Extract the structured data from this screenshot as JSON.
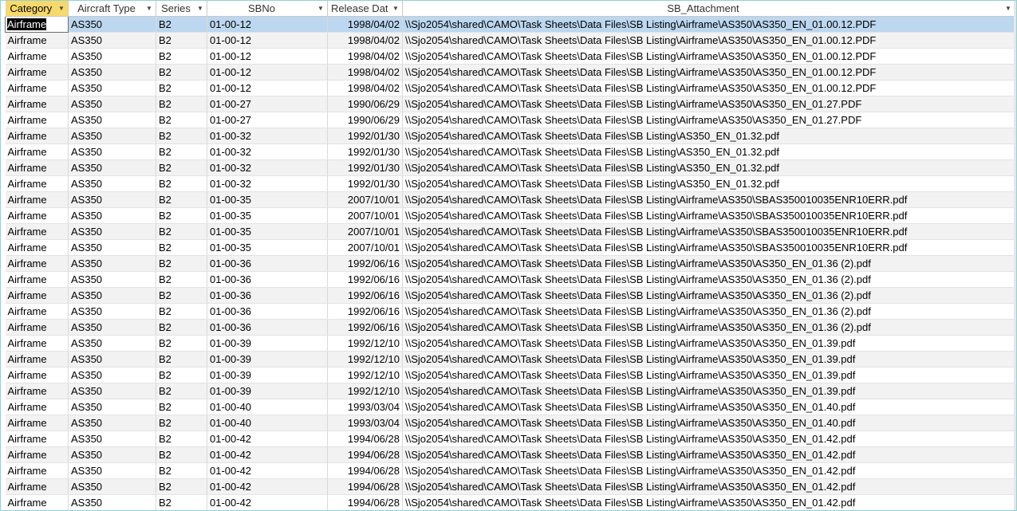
{
  "columns": [
    {
      "label": "Category"
    },
    {
      "label": "Aircraft Type"
    },
    {
      "label": "Series"
    },
    {
      "label": "SBNo"
    },
    {
      "label": "Release Dat"
    },
    {
      "label": "SB_Attachment"
    }
  ],
  "rows": [
    [
      "Airframe",
      "AS350",
      "B2",
      "01-00-12",
      "1998/04/02",
      "\\\\Sjo2054\\shared\\CAMO\\Task Sheets\\Data Files\\SB Listing\\Airframe\\AS350\\AS350_EN_01.00.12.PDF"
    ],
    [
      "Airframe",
      "AS350",
      "B2",
      "01-00-12",
      "1998/04/02",
      "\\\\Sjo2054\\shared\\CAMO\\Task Sheets\\Data Files\\SB Listing\\Airframe\\AS350\\AS350_EN_01.00.12.PDF"
    ],
    [
      "Airframe",
      "AS350",
      "B2",
      "01-00-12",
      "1998/04/02",
      "\\\\Sjo2054\\shared\\CAMO\\Task Sheets\\Data Files\\SB Listing\\Airframe\\AS350\\AS350_EN_01.00.12.PDF"
    ],
    [
      "Airframe",
      "AS350",
      "B2",
      "01-00-12",
      "1998/04/02",
      "\\\\Sjo2054\\shared\\CAMO\\Task Sheets\\Data Files\\SB Listing\\Airframe\\AS350\\AS350_EN_01.00.12.PDF"
    ],
    [
      "Airframe",
      "AS350",
      "B2",
      "01-00-12",
      "1998/04/02",
      "\\\\Sjo2054\\shared\\CAMO\\Task Sheets\\Data Files\\SB Listing\\Airframe\\AS350\\AS350_EN_01.00.12.PDF"
    ],
    [
      "Airframe",
      "AS350",
      "B2",
      "01-00-27",
      "1990/06/29",
      "\\\\Sjo2054\\shared\\CAMO\\Task Sheets\\Data Files\\SB Listing\\Airframe\\AS350\\AS350_EN_01.27.PDF"
    ],
    [
      "Airframe",
      "AS350",
      "B2",
      "01-00-27",
      "1990/06/29",
      "\\\\Sjo2054\\shared\\CAMO\\Task Sheets\\Data Files\\SB Listing\\Airframe\\AS350\\AS350_EN_01.27.PDF"
    ],
    [
      "Airframe",
      "AS350",
      "B2",
      "01-00-32",
      "1992/01/30",
      "\\\\Sjo2054\\shared\\CAMO\\Task Sheets\\Data Files\\SB Listing\\AS350_EN_01.32.pdf"
    ],
    [
      "Airframe",
      "AS350",
      "B2",
      "01-00-32",
      "1992/01/30",
      "\\\\Sjo2054\\shared\\CAMO\\Task Sheets\\Data Files\\SB Listing\\AS350_EN_01.32.pdf"
    ],
    [
      "Airframe",
      "AS350",
      "B2",
      "01-00-32",
      "1992/01/30",
      "\\\\Sjo2054\\shared\\CAMO\\Task Sheets\\Data Files\\SB Listing\\AS350_EN_01.32.pdf"
    ],
    [
      "Airframe",
      "AS350",
      "B2",
      "01-00-32",
      "1992/01/30",
      "\\\\Sjo2054\\shared\\CAMO\\Task Sheets\\Data Files\\SB Listing\\AS350_EN_01.32.pdf"
    ],
    [
      "Airframe",
      "AS350",
      "B2",
      "01-00-35",
      "2007/10/01",
      "\\\\Sjo2054\\shared\\CAMO\\Task Sheets\\Data Files\\SB Listing\\Airframe\\AS350\\SBAS350010035ENR10ERR.pdf"
    ],
    [
      "Airframe",
      "AS350",
      "B2",
      "01-00-35",
      "2007/10/01",
      "\\\\Sjo2054\\shared\\CAMO\\Task Sheets\\Data Files\\SB Listing\\Airframe\\AS350\\SBAS350010035ENR10ERR.pdf"
    ],
    [
      "Airframe",
      "AS350",
      "B2",
      "01-00-35",
      "2007/10/01",
      "\\\\Sjo2054\\shared\\CAMO\\Task Sheets\\Data Files\\SB Listing\\Airframe\\AS350\\SBAS350010035ENR10ERR.pdf"
    ],
    [
      "Airframe",
      "AS350",
      "B2",
      "01-00-35",
      "2007/10/01",
      "\\\\Sjo2054\\shared\\CAMO\\Task Sheets\\Data Files\\SB Listing\\Airframe\\AS350\\SBAS350010035ENR10ERR.pdf"
    ],
    [
      "Airframe",
      "AS350",
      "B2",
      "01-00-36",
      "1992/06/16",
      "\\\\Sjo2054\\shared\\CAMO\\Task Sheets\\Data Files\\SB Listing\\Airframe\\AS350\\AS350_EN_01.36 (2).pdf"
    ],
    [
      "Airframe",
      "AS350",
      "B2",
      "01-00-36",
      "1992/06/16",
      "\\\\Sjo2054\\shared\\CAMO\\Task Sheets\\Data Files\\SB Listing\\Airframe\\AS350\\AS350_EN_01.36 (2).pdf"
    ],
    [
      "Airframe",
      "AS350",
      "B2",
      "01-00-36",
      "1992/06/16",
      "\\\\Sjo2054\\shared\\CAMO\\Task Sheets\\Data Files\\SB Listing\\Airframe\\AS350\\AS350_EN_01.36 (2).pdf"
    ],
    [
      "Airframe",
      "AS350",
      "B2",
      "01-00-36",
      "1992/06/16",
      "\\\\Sjo2054\\shared\\CAMO\\Task Sheets\\Data Files\\SB Listing\\Airframe\\AS350\\AS350_EN_01.36 (2).pdf"
    ],
    [
      "Airframe",
      "AS350",
      "B2",
      "01-00-36",
      "1992/06/16",
      "\\\\Sjo2054\\shared\\CAMO\\Task Sheets\\Data Files\\SB Listing\\Airframe\\AS350\\AS350_EN_01.36 (2).pdf"
    ],
    [
      "Airframe",
      "AS350",
      "B2",
      "01-00-39",
      "1992/12/10",
      "\\\\Sjo2054\\shared\\CAMO\\Task Sheets\\Data Files\\SB Listing\\Airframe\\AS350\\AS350_EN_01.39.pdf"
    ],
    [
      "Airframe",
      "AS350",
      "B2",
      "01-00-39",
      "1992/12/10",
      "\\\\Sjo2054\\shared\\CAMO\\Task Sheets\\Data Files\\SB Listing\\Airframe\\AS350\\AS350_EN_01.39.pdf"
    ],
    [
      "Airframe",
      "AS350",
      "B2",
      "01-00-39",
      "1992/12/10",
      "\\\\Sjo2054\\shared\\CAMO\\Task Sheets\\Data Files\\SB Listing\\Airframe\\AS350\\AS350_EN_01.39.pdf"
    ],
    [
      "Airframe",
      "AS350",
      "B2",
      "01-00-39",
      "1992/12/10",
      "\\\\Sjo2054\\shared\\CAMO\\Task Sheets\\Data Files\\SB Listing\\Airframe\\AS350\\AS350_EN_01.39.pdf"
    ],
    [
      "Airframe",
      "AS350",
      "B2",
      "01-00-40",
      "1993/03/04",
      "\\\\Sjo2054\\shared\\CAMO\\Task Sheets\\Data Files\\SB Listing\\Airframe\\AS350\\AS350_EN_01.40.pdf"
    ],
    [
      "Airframe",
      "AS350",
      "B2",
      "01-00-40",
      "1993/03/04",
      "\\\\Sjo2054\\shared\\CAMO\\Task Sheets\\Data Files\\SB Listing\\Airframe\\AS350\\AS350_EN_01.40.pdf"
    ],
    [
      "Airframe",
      "AS350",
      "B2",
      "01-00-42",
      "1994/06/28",
      "\\\\Sjo2054\\shared\\CAMO\\Task Sheets\\Data Files\\SB Listing\\Airframe\\AS350\\AS350_EN_01.42.pdf"
    ],
    [
      "Airframe",
      "AS350",
      "B2",
      "01-00-42",
      "1994/06/28",
      "\\\\Sjo2054\\shared\\CAMO\\Task Sheets\\Data Files\\SB Listing\\Airframe\\AS350\\AS350_EN_01.42.pdf"
    ],
    [
      "Airframe",
      "AS350",
      "B2",
      "01-00-42",
      "1994/06/28",
      "\\\\Sjo2054\\shared\\CAMO\\Task Sheets\\Data Files\\SB Listing\\Airframe\\AS350\\AS350_EN_01.42.pdf"
    ],
    [
      "Airframe",
      "AS350",
      "B2",
      "01-00-42",
      "1994/06/28",
      "\\\\Sjo2054\\shared\\CAMO\\Task Sheets\\Data Files\\SB Listing\\Airframe\\AS350\\AS350_EN_01.42.pdf"
    ],
    [
      "Airframe",
      "AS350",
      "B2",
      "01-00-42",
      "1994/06/28",
      "\\\\Sjo2054\\shared\\CAMO\\Task Sheets\\Data Files\\SB Listing\\Airframe\\AS350\\AS350_EN_01.42.pdf"
    ]
  ],
  "selected_row": 0,
  "active_column": 0,
  "colors": {
    "active_header": "#f7d96b",
    "selected_row": "#bcd7ef",
    "alt_row": "#f2f2f2",
    "frame_border": "#8fd3d9"
  },
  "icons": {
    "column_dropdown": "dropdown-arrow-icon"
  }
}
